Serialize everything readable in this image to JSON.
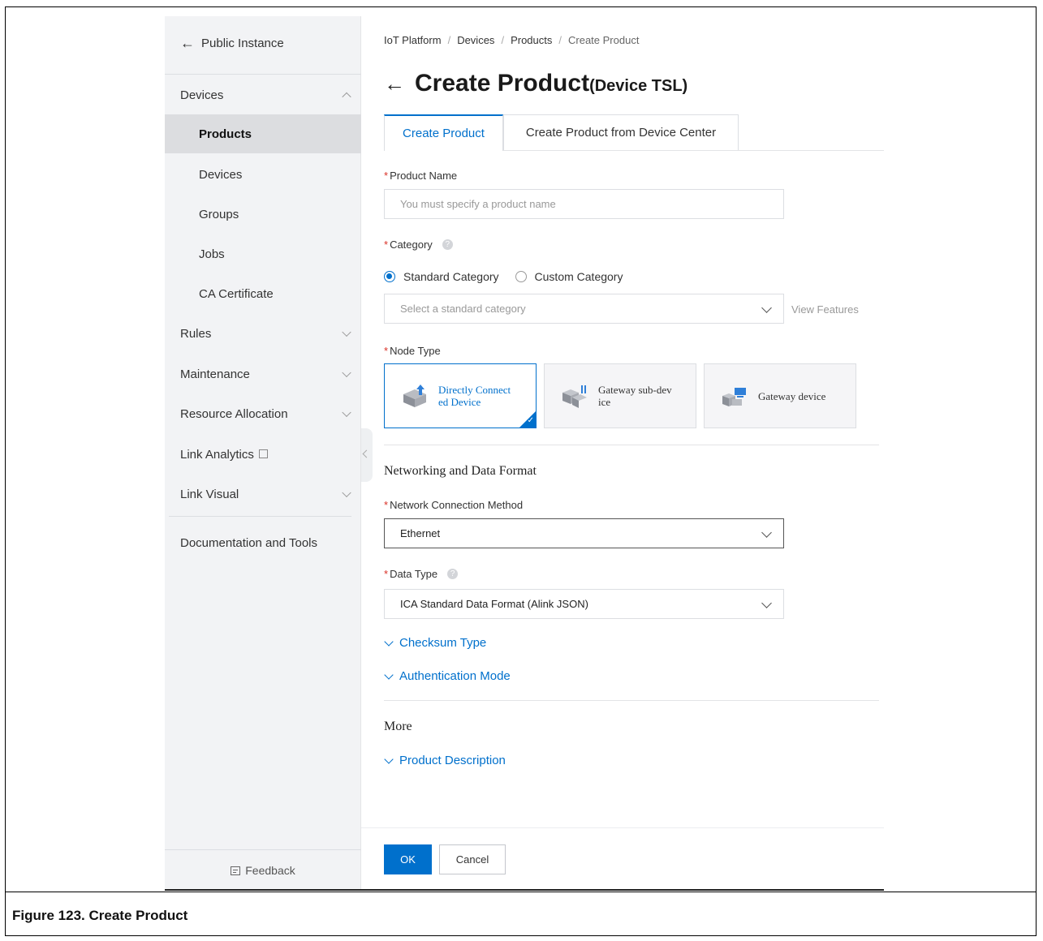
{
  "sidebar": {
    "back_label": "Public Instance",
    "sections": [
      {
        "label": "Devices",
        "chevron": "up",
        "items": [
          "Products",
          "Devices",
          "Groups",
          "Jobs",
          "CA Certificate"
        ]
      },
      {
        "label": "Rules",
        "chevron": "down"
      },
      {
        "label": "Maintenance",
        "chevron": "down"
      },
      {
        "label": "Resource Allocation",
        "chevron": "down"
      },
      {
        "label": "Link Analytics",
        "icon": "external-link-icon"
      },
      {
        "label": "Link Visual",
        "chevron": "down"
      }
    ],
    "docs_label": "Documentation and Tools",
    "feedback_label": "Feedback",
    "active_item": "Products"
  },
  "breadcrumb": [
    "IoT Platform",
    "Devices",
    "Products",
    "Create Product"
  ],
  "page_title": {
    "main": "Create Product",
    "suffix": "(Device TSL)"
  },
  "tabs": [
    {
      "label": "Create Product",
      "active": true
    },
    {
      "label": "Create Product from Device Center",
      "active": false
    }
  ],
  "form": {
    "product_name": {
      "label": "Product Name",
      "placeholder": "You must specify a product name",
      "value": ""
    },
    "category": {
      "label": "Category",
      "radios": [
        {
          "label": "Standard Category",
          "checked": true
        },
        {
          "label": "Custom Category",
          "checked": false
        }
      ],
      "select_placeholder": "Select a standard category",
      "view_features": "View Features"
    },
    "node_type": {
      "label": "Node Type",
      "options": [
        {
          "label": "Directly Connect ed Device",
          "selected": true
        },
        {
          "label": "Gateway sub-dev ice",
          "selected": false
        },
        {
          "label": "Gateway device",
          "selected": false
        }
      ]
    },
    "networking_section": "Networking and Data Format",
    "network_method": {
      "label": "Network Connection Method",
      "value": "Ethernet"
    },
    "data_type": {
      "label": "Data Type",
      "value": "ICA Standard Data Format (Alink JSON)"
    },
    "checksum_type": "Checksum Type",
    "auth_mode": "Authentication Mode",
    "more_section": "More",
    "product_description": "Product Description"
  },
  "buttons": {
    "ok": "OK",
    "cancel": "Cancel"
  },
  "caption": "Figure 123. Create Product",
  "colors": {
    "accent": "#0070cc",
    "required": "#d93026",
    "sidebar_bg": "#f2f3f5"
  }
}
